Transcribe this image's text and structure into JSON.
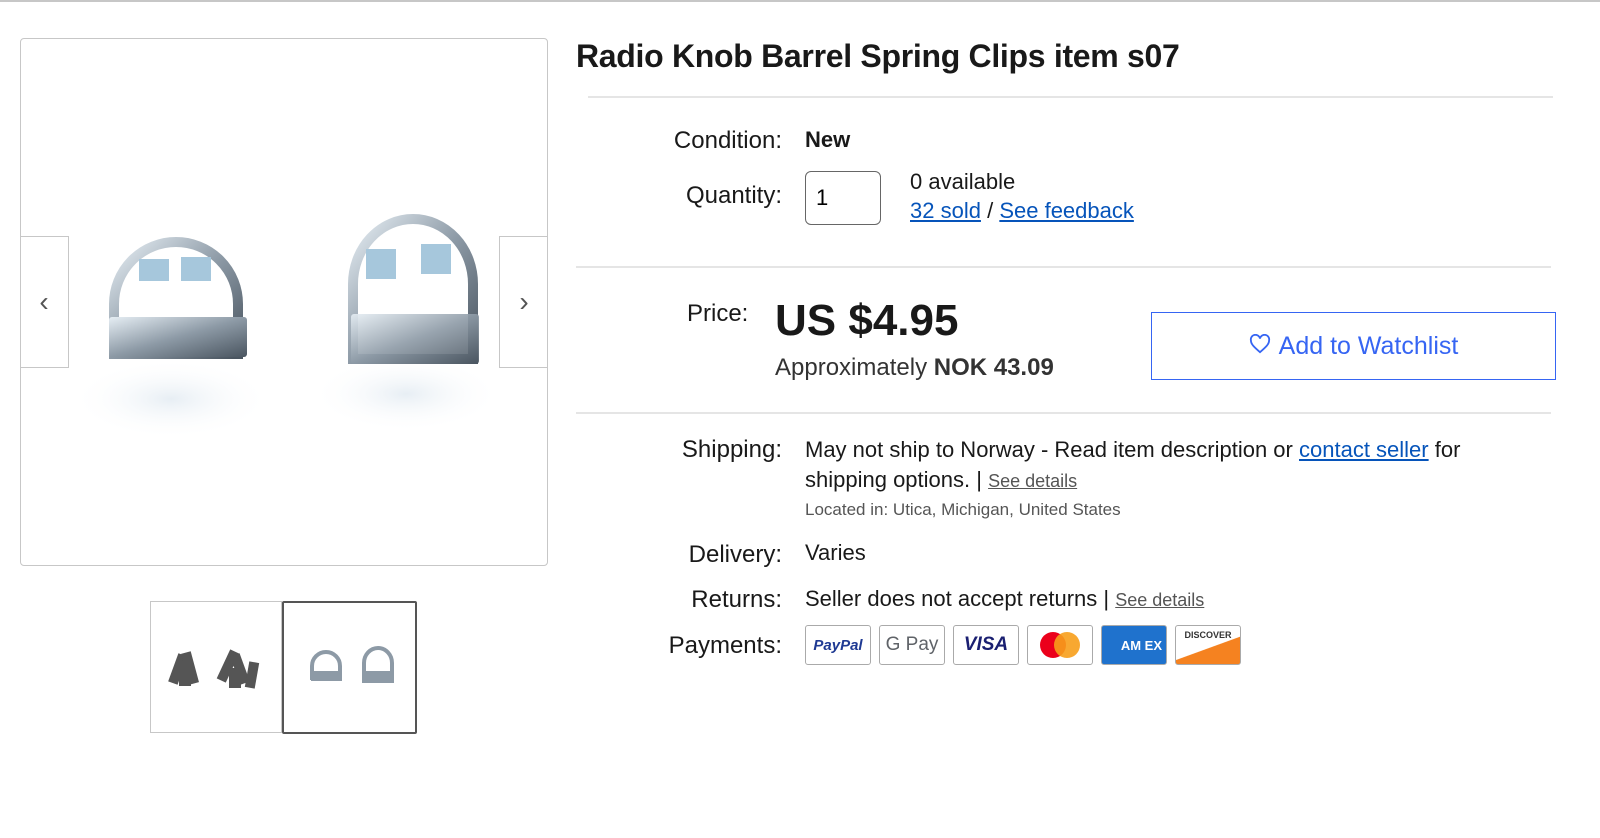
{
  "title": "Radio Knob Barrel Spring Clips item s07",
  "gallery": {
    "prev_icon": "chevron-left-icon",
    "next_icon": "chevron-right-icon",
    "selected_thumb_index": 1
  },
  "condition": {
    "label": "Condition:",
    "value": "New"
  },
  "quantity": {
    "label": "Quantity:",
    "value": "1",
    "available": "0 available",
    "sold": "32 sold",
    "separator": "/",
    "feedback": "See feedback"
  },
  "price": {
    "label": "Price:",
    "amount": "US $4.95",
    "approx_prefix": "Approximately",
    "approx_value": "NOK 43.09"
  },
  "watchlist": {
    "label": "Add to Watchlist",
    "icon": "heart-icon"
  },
  "shipping": {
    "label": "Shipping:",
    "text_before": "May not ship to Norway - Read item description or",
    "contact_link": "contact seller",
    "text_after": "for",
    "line2": "shipping options. |",
    "see_details": "See details",
    "located_label": "Located in:",
    "located_value": "Utica, Michigan, United States"
  },
  "delivery": {
    "label": "Delivery:",
    "value": "Varies"
  },
  "returns": {
    "label": "Returns:",
    "value": "Seller does not accept returns |",
    "see_details": "See details"
  },
  "payments": {
    "label": "Payments:",
    "methods": [
      {
        "name": "PayPal",
        "text": "PayPal"
      },
      {
        "name": "Google Pay",
        "text": "G Pay"
      },
      {
        "name": "Visa",
        "text": "VISA"
      },
      {
        "name": "Mastercard",
        "text": ""
      },
      {
        "name": "American Express",
        "text": "AM EX"
      },
      {
        "name": "Discover",
        "text": "DISCOVER"
      }
    ]
  },
  "colors": {
    "link": "#0654ba",
    "accent": "#3665f3",
    "text": "#191919",
    "divider": "#e5e5e5"
  }
}
